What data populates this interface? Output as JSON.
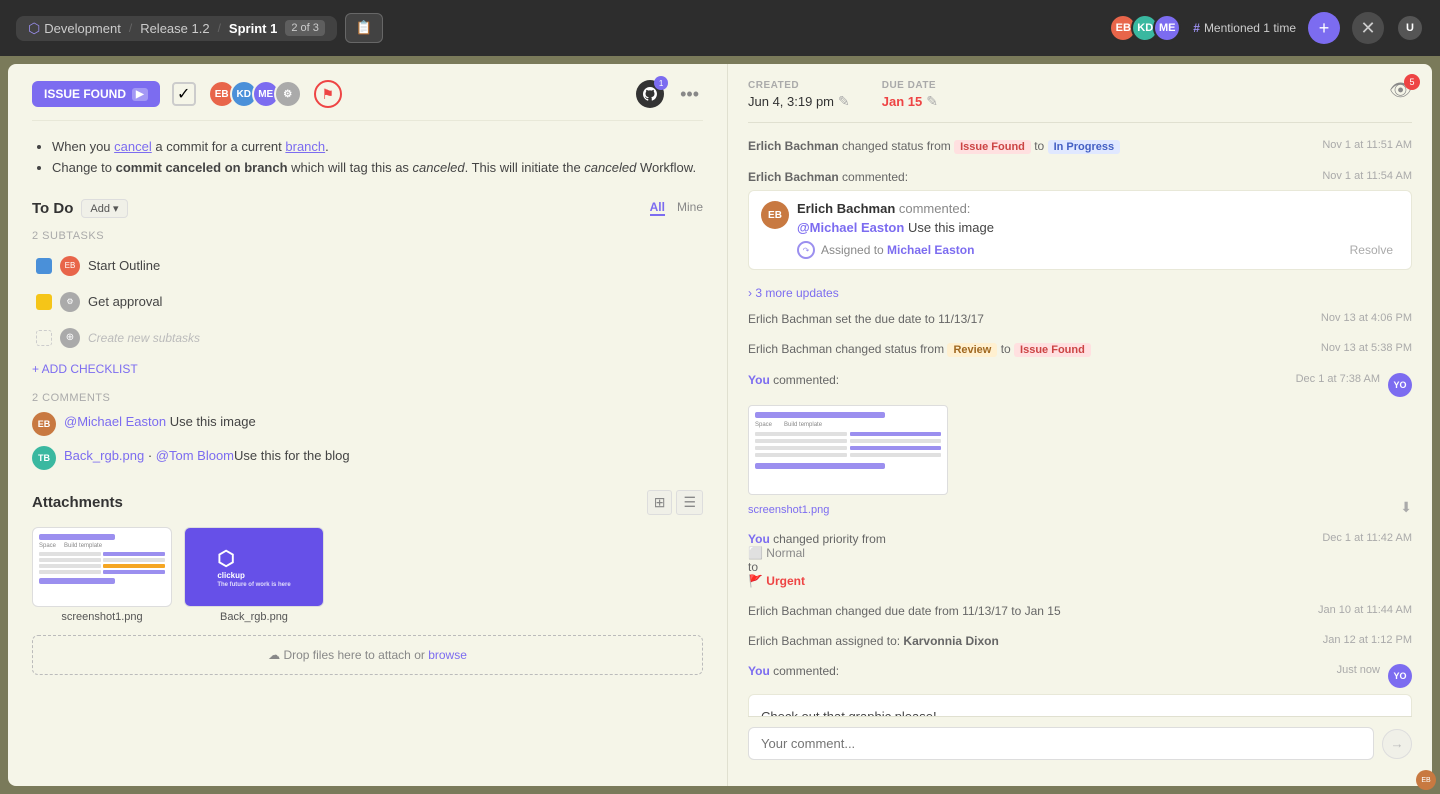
{
  "topbar": {
    "workspace": "Development",
    "release": "Release 1.2",
    "sprint": "Sprint 1",
    "sprint_num": "2",
    "sprint_of": "of 3",
    "mentioned_label": "Mentioned 1 time"
  },
  "issue": {
    "status": "ISSUE FOUND",
    "github_count": "1",
    "watch_count": "5",
    "created_label": "CREATED",
    "created_value": "Jun 4, 3:19 pm",
    "due_label": "DUE DATE",
    "due_value": "Jan 15"
  },
  "content": {
    "paragraph1_a": "When you ",
    "cancel_link": "cancel",
    "paragraph1_b": " a commit for a current ",
    "branch_link": "branch",
    "bullet1_pre": "Change to ",
    "bullet1_bold1": "commit canceled on branch",
    "bullet1_mid": " which will tag this as ",
    "bullet1_italic": "canceled",
    "bullet1_post": ". This will initiate the ",
    "bullet1_italic2": "canceled",
    "bullet1_end": " Workflow."
  },
  "todo": {
    "title": "To Do",
    "add_label": "Add ▾",
    "filter_all": "All",
    "filter_mine": "Mine",
    "subtasks_label": "2 SUBTASKS",
    "subtasks": [
      {
        "text": "Start Outline",
        "color": "blue"
      },
      {
        "text": "Get approval",
        "color": "yellow"
      },
      {
        "text": "Create new subtasks",
        "ghost": true
      }
    ],
    "add_checklist": "+ ADD CHECKLIST"
  },
  "comments_section": {
    "label": "2 COMMENTS",
    "comments": [
      {
        "user": "EB",
        "color": "brown",
        "text": "@Michael Easton Use this image"
      },
      {
        "user": "TB",
        "color": "teal",
        "text": "Back_rgb.png · @Tom BloomUse this for the blog"
      }
    ]
  },
  "attachments": {
    "title": "Attachments",
    "items": [
      {
        "name": "screenshot1.png",
        "type": "white"
      },
      {
        "name": "Back_rgb.png",
        "type": "purple"
      }
    ],
    "drop_text": "Drop files here to attach or ",
    "browse_link": "browse"
  },
  "activity": {
    "items": [
      {
        "type": "status_change",
        "actor": "Erlich Bachman",
        "from": "Issue Found",
        "to": "In Progress",
        "time": "Nov 1 at 11:51 AM"
      },
      {
        "type": "comment",
        "actor": "Erlich Bachman",
        "actor_color": "brown",
        "action": "commented:",
        "time": "Nov 1 at 11:54 AM",
        "mention": "@Michael Easton",
        "body": " Use this image",
        "assign_to": "Michael Easton"
      },
      {
        "type": "more_updates",
        "text": "› 3 more updates"
      },
      {
        "type": "simple",
        "text": "Erlich Bachman set the due date to 11/13/17",
        "time": "Nov 13 at 4:06 PM"
      },
      {
        "type": "status_change2",
        "actor": "Erlich Bachman",
        "from": "Review",
        "to": "Issue Found",
        "time": "Nov 13 at 5:38 PM"
      },
      {
        "type": "comment_you",
        "actor": "You",
        "action": "commented:",
        "time": "Dec 1 at 7:38 AM",
        "has_image": true,
        "image_name": "screenshot1.png"
      },
      {
        "type": "priority_change",
        "actor": "You",
        "from_priority": "Normal",
        "to_priority": "Urgent",
        "time": "Dec 1 at 11:42 AM"
      },
      {
        "type": "simple",
        "text": "Erlich Bachman changed due date from 11/13/17 to Jan 15",
        "time": "Jan 10 at 11:44 AM"
      },
      {
        "type": "simple",
        "text": "Erlich Bachman assigned to: Karvonnia Dixon",
        "bold_part": "Karvonnia Dixon",
        "time": "Jan 12 at 1:12 PM"
      },
      {
        "type": "comment_you2",
        "actor": "You",
        "action": "commented:",
        "time": "Just now",
        "body": "Check out that graphic please!"
      }
    ]
  },
  "comment_input": {
    "placeholder": "Your comment..."
  }
}
